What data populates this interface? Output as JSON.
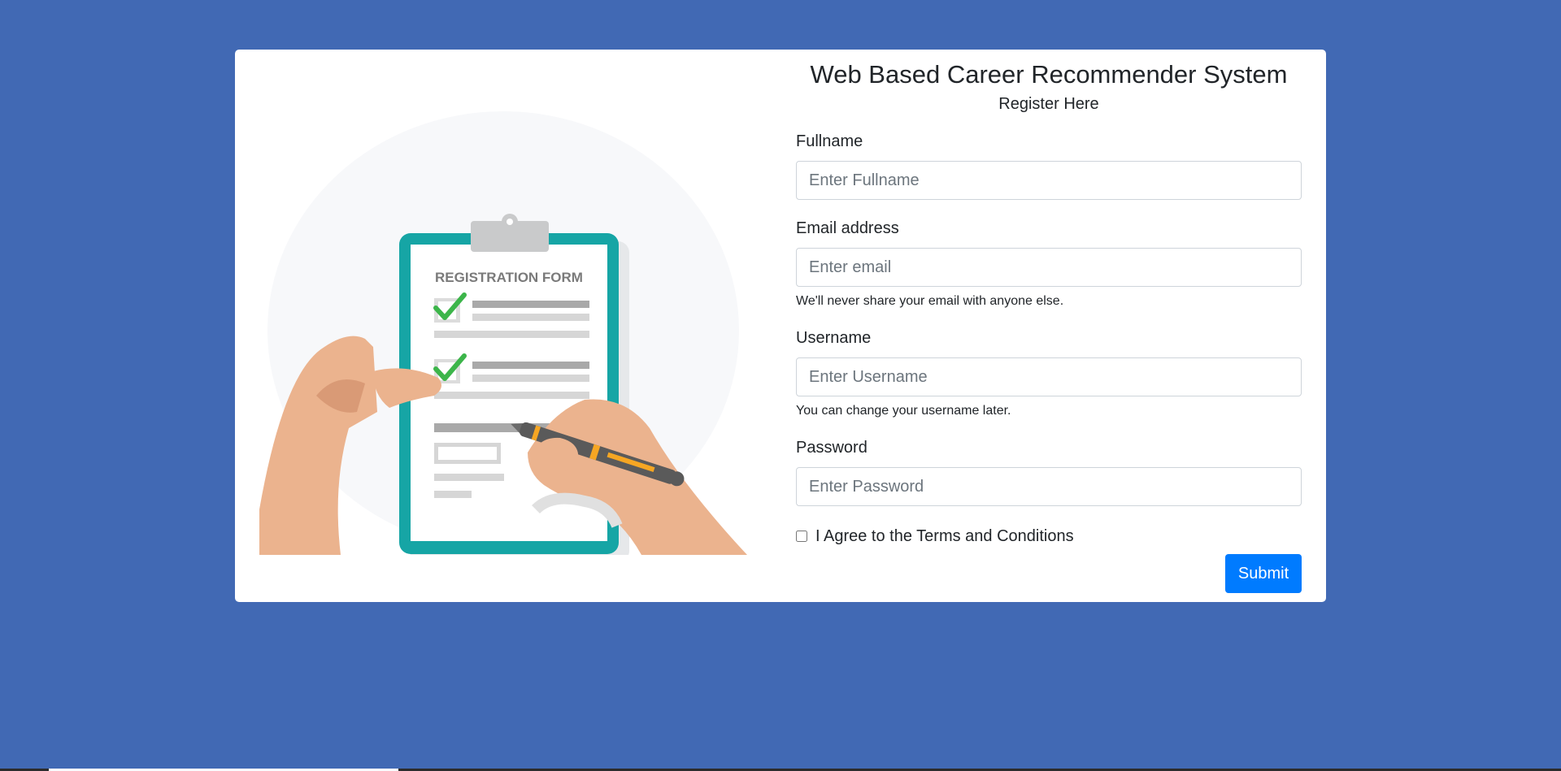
{
  "header": {
    "title": "Web Based Career Recommender System",
    "subtitle": "Register Here"
  },
  "illustration": {
    "form_heading": "REGISTRATION FORM",
    "icon": "registration-form-illustration"
  },
  "form": {
    "fullname": {
      "label": "Fullname",
      "placeholder": "Enter Fullname",
      "value": ""
    },
    "email": {
      "label": "Email address",
      "placeholder": "Enter email",
      "value": "",
      "help": "We'll never share your email with anyone else."
    },
    "username": {
      "label": "Username",
      "placeholder": "Enter Username",
      "value": "",
      "help": "You can change your username later."
    },
    "password": {
      "label": "Password",
      "placeholder": "Enter Password",
      "value": ""
    },
    "terms": {
      "label": "I Agree to the Terms and Conditions",
      "checked": false
    },
    "submit_label": "Submit"
  },
  "colors": {
    "background": "#4169b4",
    "card": "#ffffff",
    "primary": "#007bff",
    "clipboard": "#16a5a5",
    "check": "#3cb54a",
    "skin": "#ebb38e"
  }
}
